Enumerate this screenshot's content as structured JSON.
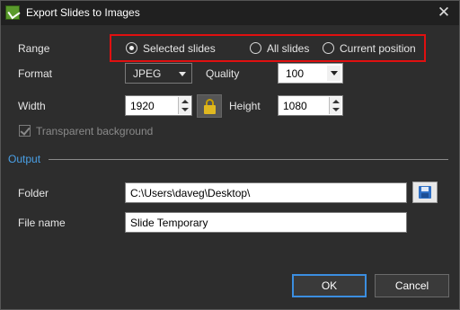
{
  "window": {
    "title": "Export Slides to Images",
    "close_glyph": "✕"
  },
  "range": {
    "label": "Range",
    "options": [
      {
        "label": "Selected slides",
        "checked": true
      },
      {
        "label": "All slides",
        "checked": false
      },
      {
        "label": "Current position",
        "checked": false
      }
    ],
    "highlight_color": "#e01010"
  },
  "format": {
    "label": "Format",
    "value": "JPEG"
  },
  "quality": {
    "label": "Quality",
    "value": "100"
  },
  "width": {
    "label": "Width",
    "value": "1920"
  },
  "height": {
    "label": "Height",
    "value": "1080"
  },
  "transparent": {
    "label": "Transparent background",
    "checked": true,
    "enabled": false
  },
  "output": {
    "section_title": "Output",
    "folder_label": "Folder",
    "folder_value": "C:\\Users\\daveg\\Desktop\\",
    "filename_label": "File name",
    "filename_value": "Slide Temporary"
  },
  "buttons": {
    "ok": "OK",
    "cancel": "Cancel"
  },
  "colors": {
    "accent": "#3b8ee0",
    "section": "#4aa0e6",
    "background": "#2d2d2d"
  }
}
